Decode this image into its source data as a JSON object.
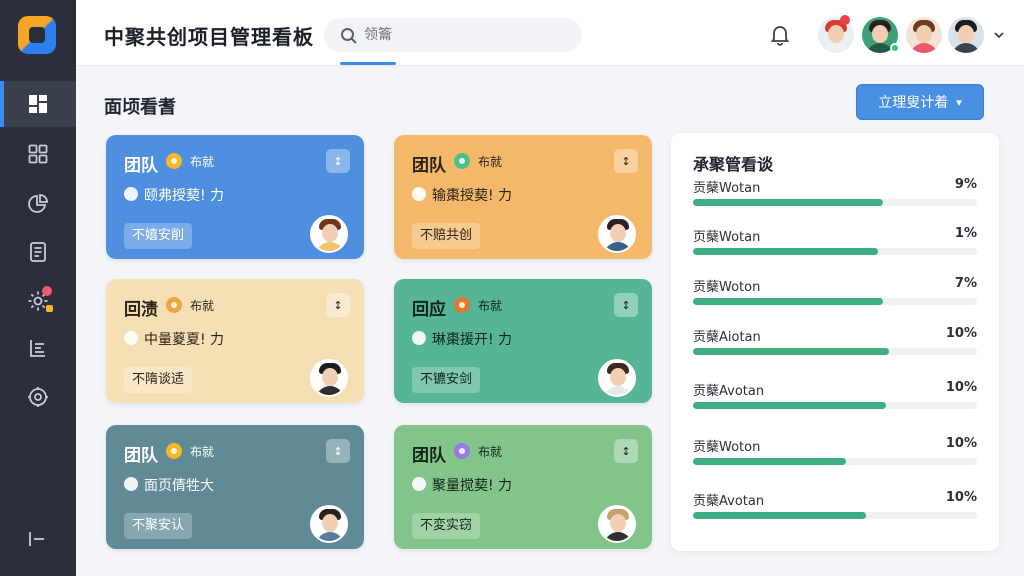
{
  "app": {
    "title": "中聚共创项目管理看板"
  },
  "search": {
    "placeholder": "领籥"
  },
  "header": {
    "accent_color": "#3d8bf5"
  },
  "sidebar": {
    "items": [
      {
        "icon": "dashboard-icon",
        "active": true
      },
      {
        "icon": "grid-icon",
        "active": false
      },
      {
        "icon": "pie-chart-icon",
        "active": false
      },
      {
        "icon": "document-icon",
        "active": false
      },
      {
        "icon": "gear-badge-icon",
        "active": false
      },
      {
        "icon": "list-icon",
        "active": false
      },
      {
        "icon": "settings-icon",
        "active": false
      }
    ]
  },
  "section": {
    "title": "面顷看耆"
  },
  "primary_button": {
    "label": "立理叟计着"
  },
  "cards": [
    {
      "title": "团队",
      "status": "布就",
      "line": "颐弗授葜! 力",
      "tag": "不嬉安削",
      "color": "#4f8fe0",
      "badge_color": "#f5b82a"
    },
    {
      "title": "团队",
      "status": "布就",
      "line": "输棗授葜! 力",
      "tag": "不赔共创",
      "color": "#f4b86b",
      "badge_color": "#4fbf8a"
    },
    {
      "title": "回渍",
      "status": "布就",
      "line": "中量葼夏! 力",
      "tag": "不隋谈适",
      "color": "#f5dfb4",
      "badge_color": "#f0a640"
    },
    {
      "title": "回应",
      "status": "布就",
      "line": "琳棗援开! 力",
      "tag": "不镳安剑",
      "color": "#55b596",
      "badge_color": "#e07830"
    },
    {
      "title": "团队",
      "status": "布就",
      "line": "面页倩牲大",
      "tag": "不聚安认",
      "color": "#5f8a96",
      "badge_color": "#f5b82a"
    },
    {
      "title": "团队",
      "status": "布就",
      "line": "聚量搅葜! 力",
      "tag": "不変实窃",
      "color": "#82c48a",
      "badge_color": "#9a7be0"
    }
  ],
  "panel": {
    "title": "承聚管看谈",
    "rows": [
      {
        "label": "贡蘖Wotan",
        "value": "9%",
        "fill": 0.67
      },
      {
        "label": "页蘖Wotan",
        "value": "1%",
        "fill": 0.65
      },
      {
        "label": "贡蘖Woton",
        "value": "7%",
        "fill": 0.67
      },
      {
        "label": "贡蘖Aiotan",
        "value": "10%",
        "fill": 0.69
      },
      {
        "label": "贡蘖Avotan",
        "value": "10%",
        "fill": 0.68
      },
      {
        "label": "贡蘖Woton",
        "value": "10%",
        "fill": 0.54
      },
      {
        "label": "贡蘖Avotan",
        "value": "10%",
        "fill": 0.61
      }
    ]
  }
}
